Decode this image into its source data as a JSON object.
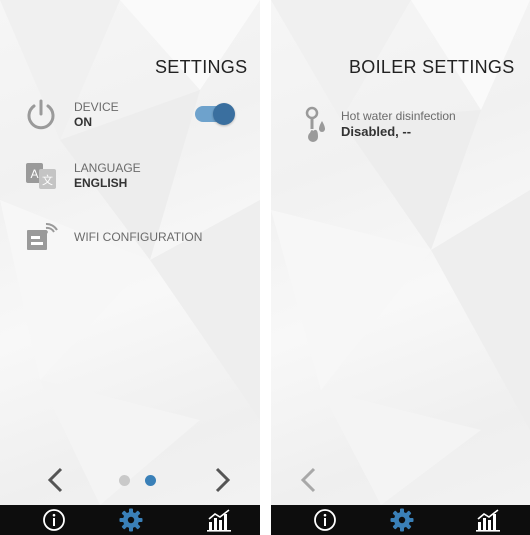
{
  "colors": {
    "accent": "#3a6f9f",
    "accent_light": "#6ea2cc",
    "inactive_dot": "#c9c9c9",
    "bottom_bar": "#0d0d0d",
    "icon_gray": "#9a9a9a"
  },
  "left_screen": {
    "title": "SETTINGS",
    "items": [
      {
        "icon": "power-icon",
        "label": "DEVICE",
        "value": "ON",
        "toggle_on": true
      },
      {
        "icon": "language-icon",
        "label": "LANGUAGE",
        "value": "ENGLISH"
      },
      {
        "icon": "wifi-config-icon",
        "label": "WIFI CONFIGURATION",
        "value": ""
      }
    ],
    "pager": {
      "total": 2,
      "active": 2
    },
    "nav": {
      "prev_icon": "chevron-left-icon",
      "next_icon": "chevron-right-icon"
    }
  },
  "right_screen": {
    "title": "BOILER SETTINGS",
    "items": [
      {
        "icon": "water-thermometer-icon",
        "label": "Hot water disinfection",
        "value": "Disabled, --"
      }
    ],
    "nav": {
      "prev_icon": "chevron-left-icon"
    }
  },
  "bottom_bar": {
    "buttons": [
      {
        "icon": "info-icon"
      },
      {
        "icon": "gear-icon"
      },
      {
        "icon": "statistics-icon"
      }
    ]
  }
}
